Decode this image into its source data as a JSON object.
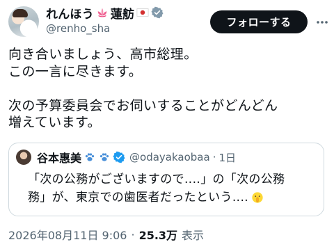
{
  "author": {
    "display_name": "れんほう",
    "display_name_2": "蓮舫",
    "handle": "@renho_sha",
    "icons": [
      "lotus-icon",
      "japan-flag-icon",
      "verified-badge-icon"
    ],
    "verified_color": "#829aab"
  },
  "follow_button": {
    "label": "フォローする"
  },
  "tweet": {
    "lines": [
      "向き合いましょう、高市総理。",
      "この一言に尽きます。",
      "次の予算委員会でお伺いすることがどんどん",
      "増えています。"
    ]
  },
  "quoted": {
    "display_name": "谷本惠美",
    "icons": [
      "paw-prints-icon",
      "paw-prints-icon",
      "verified-badge-icon"
    ],
    "verified_color": "#1d9bf0",
    "handle": "@odayakaobaa",
    "separator": "·",
    "time": "1日",
    "lines": [
      "「次の公務がございますので‥‥」の「次の公務",
      "務」が、東京での歯医者だったという‥‥"
    ],
    "trailing_icon": "shushing-face-icon"
  },
  "footer": {
    "timestamp": "2026年08月11日 9:06",
    "separator": "·",
    "views_count": "25.3万",
    "views_label": "表示"
  }
}
